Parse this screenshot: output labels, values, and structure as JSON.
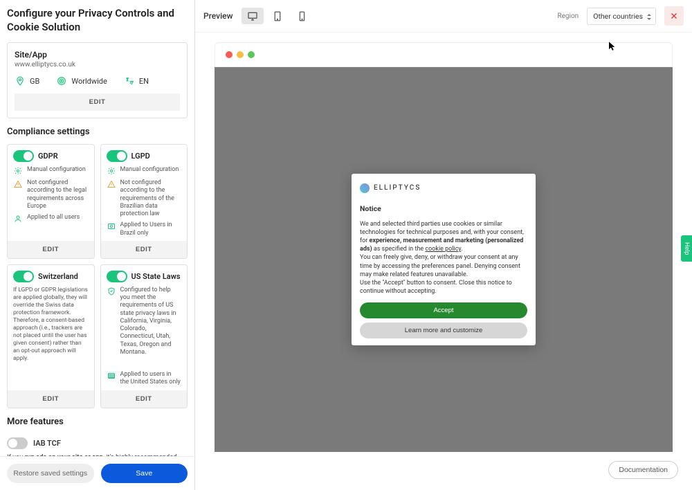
{
  "sidebar": {
    "title": "Configure your Privacy Controls and Cookie Solution",
    "site_card": {
      "label": "Site/App",
      "value": "www.elliptycs.co.uk",
      "badges": {
        "country": "GB",
        "scope": "Worldwide",
        "lang": "EN"
      },
      "edit": "EDIT"
    },
    "compliance_title": "Compliance settings",
    "compliance": {
      "gdpr": {
        "title": "GDPR",
        "manual": "Manual configuration",
        "warn": "Not configured according to the legal requirements across Europe",
        "scope": "Applied to all users",
        "edit": "EDIT"
      },
      "lgpd": {
        "title": "LGPD",
        "manual": "Manual configuration",
        "warn": "Not configured according to the requirements of the Brazilian data protection law",
        "scope": "Applied to Users in Brazil only",
        "edit": "EDIT"
      },
      "switzerland": {
        "title": "Switzerland",
        "desc": "If LGPD or GDPR legislations are applied globally, they will override the Swiss data protection framework. Therefore, a consent-based approach (i.e., trackers are not placed until the user has given consent) rather than an opt-out approach will apply.",
        "edit": "EDIT"
      },
      "usstate": {
        "title": "US State Laws",
        "desc": "Configured to help you meet the requirements of US state privacy laws in California, Virginia, Colorado, Connecticut, Utah, Texas, Oregon and Montana.",
        "scope": "Applied to users in the United States only",
        "edit": "EDIT"
      }
    },
    "more_title": "More features",
    "iab": {
      "title": "IAB TCF",
      "desc_pre": "If you ",
      "desc_bold": "run ads on your site or app",
      "desc_post": ", it's highly recommended that you enable the IAB Transparency and Consent"
    },
    "footer": {
      "restore": "Restore saved settings",
      "save": "Save"
    }
  },
  "topbar": {
    "preview": "Preview",
    "region_label": "Region",
    "region_value": "Other countries"
  },
  "notice": {
    "brand": "ELLIPTYCS",
    "title": "Notice",
    "p1a": "We and selected third parties use cookies or similar technologies for technical purposes and, with your consent, for ",
    "p1b": "experience, measurement and marketing (personalized ads)",
    "p1c": " as specified in the ",
    "p1link": "cookie policy",
    "p1d": ".",
    "p2": "You can freely give, deny, or withdraw your consent at any time by accessing the preferences panel. Denying consent may make related features unavailable.",
    "p3": "Use the \"Accept\" button to consent. Close this notice to continue without accepting.",
    "accept": "Accept",
    "learn": "Learn more and customize"
  },
  "help": "Help",
  "documentation": "Documentation",
  "colors": {
    "traffic_red": "#f45c54",
    "traffic_yellow": "#f7bd45",
    "traffic_green": "#5cc75c"
  }
}
